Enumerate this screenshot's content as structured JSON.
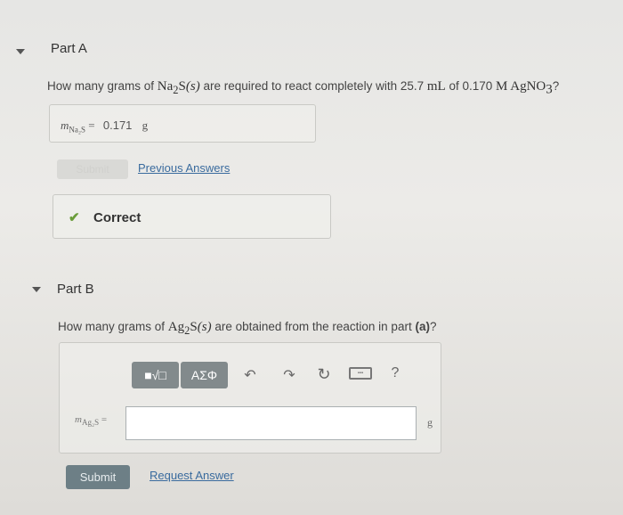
{
  "part_a": {
    "title": "Part A",
    "question": {
      "prefix": "How many grams of ",
      "compound": "Na",
      "compound_sub": "2",
      "compound_rest": "S",
      "state": "(s)",
      "middle": " are required to react completely with 25.7 ",
      "volume_unit": "mL",
      "of_text": " of 0.170 ",
      "conc_unit": "M",
      "reagent": " AgNO",
      "reagent_sub": "3",
      "suffix": "?"
    },
    "answer": {
      "var": "m",
      "var_sub": "Na₂S",
      "equals": "=",
      "value": "0.171",
      "unit": "g"
    },
    "submit_label": "Submit",
    "previous_answers_label": "Previous Answers",
    "correct_label": "Correct",
    "check_icon": "checkmark-icon"
  },
  "part_b": {
    "title": "Part B",
    "question": {
      "prefix": "How many grams of ",
      "compound": "Ag",
      "compound_sub": "2",
      "compound_rest": "S",
      "state": "(s)",
      "middle": " are obtained from the reaction in part ",
      "part_ref": "(a)",
      "suffix": "?"
    },
    "toolbar": {
      "template_label": "■√□",
      "symbols_label": "ΑΣΦ",
      "help_label": "?"
    },
    "input": {
      "var": "m",
      "var_sub": "Ag₂S",
      "equals": "=",
      "value": "",
      "unit": "g"
    },
    "submit_label": "Submit",
    "request_answer_label": "Request Answer"
  },
  "colors": {
    "link": "#3a6b9e",
    "check": "#6a9c3a",
    "toolbar_button": "#828a8c",
    "submit_button": "#6d7f86"
  }
}
